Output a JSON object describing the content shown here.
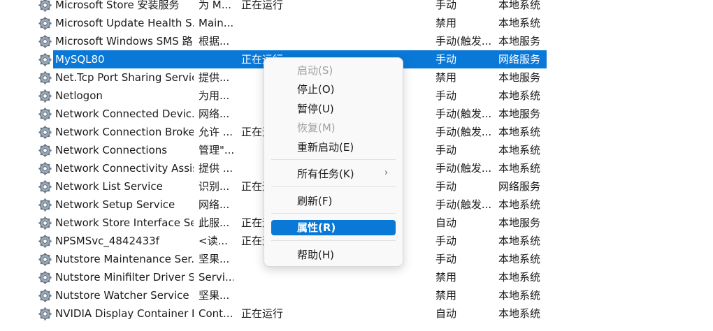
{
  "services": [
    {
      "name": "Microsoft Store 安装服务",
      "description": "为 M...",
      "status": "正在运行",
      "startup_type": "手动",
      "log_on_as": "本地系统"
    },
    {
      "name": "Microsoft Update Health S...",
      "description": "Main...",
      "status": "",
      "startup_type": "禁用",
      "log_on_as": "本地系统"
    },
    {
      "name": "Microsoft Windows SMS 路...",
      "description": "根据...",
      "status": "",
      "startup_type": "手动(触发...",
      "log_on_as": "本地服务"
    },
    {
      "name": "MySQL80",
      "description": "",
      "status": "正在运行",
      "startup_type": "手动",
      "log_on_as": "网络服务",
      "selected": true
    },
    {
      "name": "Net.Tcp Port Sharing Service",
      "description": "提供...",
      "status": "",
      "startup_type": "禁用",
      "log_on_as": "本地服务"
    },
    {
      "name": "Netlogon",
      "description": "为用...",
      "status": "",
      "startup_type": "手动",
      "log_on_as": "本地系统"
    },
    {
      "name": "Network Connected Devic...",
      "description": "网络...",
      "status": "",
      "startup_type": "手动(触发...",
      "log_on_as": "本地服务"
    },
    {
      "name": "Network Connection Broker",
      "description": "允许 ...",
      "status": "正在运行",
      "startup_type": "手动(触发...",
      "log_on_as": "本地系统"
    },
    {
      "name": "Network Connections",
      "description": "管理\"...",
      "status": "",
      "startup_type": "手动",
      "log_on_as": "本地系统"
    },
    {
      "name": "Network Connectivity Assis...",
      "description": "提供 ...",
      "status": "",
      "startup_type": "手动(触发...",
      "log_on_as": "本地系统"
    },
    {
      "name": "Network List Service",
      "description": "识别...",
      "status": "正在运行",
      "startup_type": "手动",
      "log_on_as": "网络服务"
    },
    {
      "name": "Network Setup Service",
      "description": "网络...",
      "status": "",
      "startup_type": "手动(触发...",
      "log_on_as": "本地系统"
    },
    {
      "name": "Network Store Interface Se...",
      "description": "此服...",
      "status": "正在运行",
      "startup_type": "自动",
      "log_on_as": "本地服务"
    },
    {
      "name": "NPSMSvc_4842433f",
      "description": "<读...",
      "status": "正在运行",
      "startup_type": "手动",
      "log_on_as": "本地系统"
    },
    {
      "name": "Nutstore Maintenance Ser...",
      "description": "坚果...",
      "status": "",
      "startup_type": "手动",
      "log_on_as": "本地系统"
    },
    {
      "name": "Nutstore Minifilter Driver S...",
      "description": "Servi...",
      "status": "",
      "startup_type": "禁用",
      "log_on_as": "本地系统"
    },
    {
      "name": "Nutstore Watcher Service",
      "description": "坚果...",
      "status": "",
      "startup_type": "禁用",
      "log_on_as": "本地系统"
    },
    {
      "name": "NVIDIA Display Container LS",
      "description": "Cont...",
      "status": "正在运行",
      "startup_type": "自动",
      "log_on_as": "本地系统"
    }
  ],
  "context_menu": {
    "items": [
      {
        "label": "启动(S)",
        "disabled": true
      },
      {
        "label": "停止(O)"
      },
      {
        "label": "暂停(U)"
      },
      {
        "label": "恢复(M)",
        "disabled": true
      },
      {
        "label": "重新启动(E)"
      },
      {
        "label": "所有任务(K)",
        "submenu": true
      },
      {
        "label": "刷新(F)"
      },
      {
        "label": "属性(R)",
        "highlighted": true
      },
      {
        "label": "帮助(H)"
      }
    ]
  },
  "colors": {
    "selection": "#0a78d7",
    "disabled_text": "#a0a0a0",
    "gear_fill": "#8fa0b0"
  },
  "icons": {
    "service": "gear-icon",
    "submenu": "chevron-right-icon"
  }
}
